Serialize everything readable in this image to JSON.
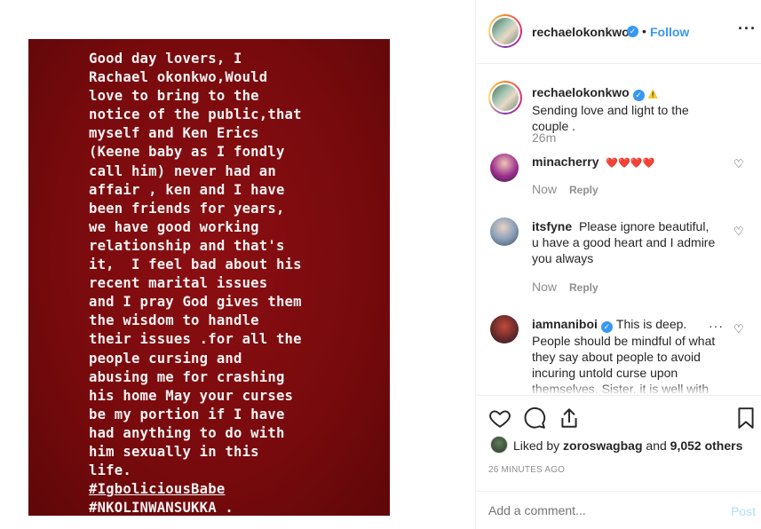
{
  "post": {
    "caption_lines": [
      "Good day lovers, I",
      "Rachael okonkwo,Would",
      "love to bring to the",
      "notice of the public,that",
      "myself and Ken Erics",
      "(Keene baby as I fondly",
      "call him) never had an",
      "affair , ken and I have",
      "been friends for years,",
      "we have good working",
      "relationship and that's",
      "it,  I feel bad about his",
      "recent marital issues",
      "and I pray God gives them",
      "the wisdom to handle",
      "their issues .for all the",
      "people cursing and",
      "abusing me for crashing",
      "his home May your curses",
      "be my portion if I have",
      "had anything to do with",
      "him sexually in this",
      "life."
    ],
    "hashtags": [
      "#IgboliciousBabe",
      "#NKOLINWANSUKKA ."
    ],
    "background_color": "#7a0b0e"
  },
  "header": {
    "username": "rechaelokonkwo",
    "dot": "•",
    "follow_label": "Follow",
    "more_label": "···"
  },
  "comments": [
    {
      "username": "rechaelokonkwo",
      "badge": "⚠️",
      "text": "Sending love and light to the couple .",
      "time": "26m"
    },
    {
      "username": "minacherry",
      "text": "❤️❤️❤️❤️",
      "time": "Now",
      "reply": "Reply"
    },
    {
      "username": "itsfyne",
      "text": "Please ignore beautiful, u have a good heart and I admire you always",
      "time": "Now",
      "reply": "Reply"
    },
    {
      "username": "iamnaniboi",
      "text": "This is deep. People should be mindful of what they say about people to avoid incuring untold curse upon themselves. Sister, it is well with"
    }
  ],
  "likes": {
    "liked_by_prefix": "Liked by",
    "liked_by_user": "zoroswagbag",
    "and_word": "and",
    "others": "9,052 others"
  },
  "timestamp": "26 MINUTES AGO",
  "add_comment": {
    "placeholder": "Add a comment...",
    "post_label": "Post"
  },
  "colors": {
    "accent": "#3897f0",
    "text": "#262626",
    "muted": "#8e8e8e"
  }
}
